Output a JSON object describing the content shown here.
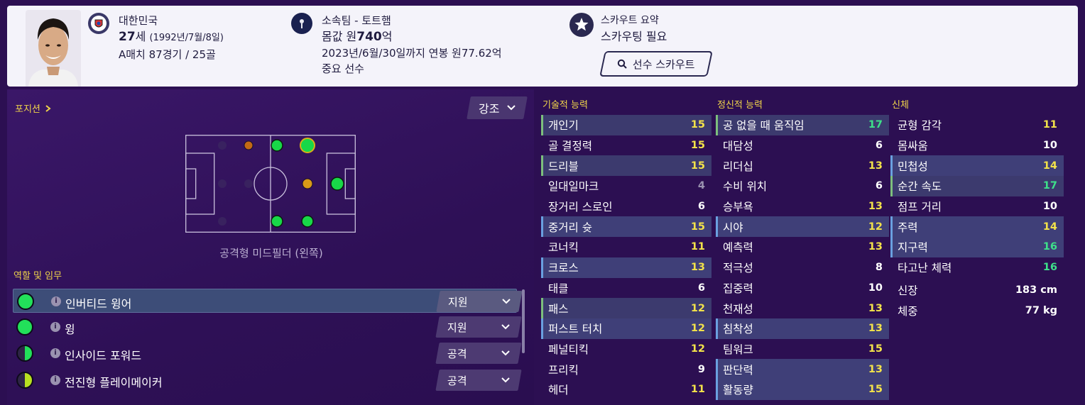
{
  "header": {
    "nation": "대한민국",
    "age_num": "27",
    "age_suffix": "세",
    "birth": "(1992년/7월/8일)",
    "caps": "A매치 87경기 / 25골",
    "club": "소속팀 - 토트햄",
    "value_prefix": "몸값 원",
    "value_num": "740",
    "value_suffix": "억",
    "contract": "2023년/6월/30일까지 연봉 원77.62억",
    "status": "중요 선수",
    "scout_title": "스카우트 요약",
    "scout_status": "스카우팅 필요",
    "scout_button": "선수 스카우트"
  },
  "left": {
    "positions_title": "포지션",
    "emphasis_label": "강조",
    "position_name": "공격형 미드필더 (왼쪽)",
    "roles_title": "역할 및 임무",
    "roles": [
      {
        "name": "인버티드 윙어",
        "duty": "지원",
        "fill": "full"
      },
      {
        "name": "윙",
        "duty": "지원",
        "fill": "full"
      },
      {
        "name": "인사이드 포워드",
        "duty": "공격",
        "fill": "half"
      },
      {
        "name": "전진형 플레이메이커",
        "duty": "공격",
        "fill": "half"
      }
    ]
  },
  "attributes": {
    "technical": {
      "title": "기술적 능력",
      "items": [
        {
          "name": "개인기",
          "value": "15",
          "color": "#f2e24a",
          "hl": "green"
        },
        {
          "name": "골 결정력",
          "value": "15",
          "color": "#f2e24a",
          "hl": ""
        },
        {
          "name": "드리블",
          "value": "15",
          "color": "#f2e24a",
          "hl": "green"
        },
        {
          "name": "일대일마크",
          "value": "4",
          "color": "#9a92b0",
          "hl": ""
        },
        {
          "name": "장거리 스로인",
          "value": "6",
          "color": "#ffffff",
          "hl": ""
        },
        {
          "name": "중거리 슛",
          "value": "15",
          "color": "#f2e24a",
          "hl": "blue"
        },
        {
          "name": "코너킥",
          "value": "11",
          "color": "#f2e24a",
          "hl": ""
        },
        {
          "name": "크로스",
          "value": "13",
          "color": "#f2e24a",
          "hl": "blue"
        },
        {
          "name": "태클",
          "value": "6",
          "color": "#ffffff",
          "hl": ""
        },
        {
          "name": "패스",
          "value": "12",
          "color": "#f2e24a",
          "hl": "green"
        },
        {
          "name": "퍼스트 터치",
          "value": "12",
          "color": "#f2e24a",
          "hl": "blue"
        },
        {
          "name": "페널티킥",
          "value": "12",
          "color": "#f2e24a",
          "hl": ""
        },
        {
          "name": "프리킥",
          "value": "9",
          "color": "#ffffff",
          "hl": ""
        },
        {
          "name": "헤더",
          "value": "11",
          "color": "#f2e24a",
          "hl": ""
        }
      ]
    },
    "mental": {
      "title": "정신적 능력",
      "items": [
        {
          "name": "공 없을 때 움직임",
          "value": "17",
          "color": "#3ee08a",
          "hl": "green"
        },
        {
          "name": "대담성",
          "value": "6",
          "color": "#ffffff",
          "hl": ""
        },
        {
          "name": "리더십",
          "value": "13",
          "color": "#f2e24a",
          "hl": ""
        },
        {
          "name": "수비 위치",
          "value": "6",
          "color": "#ffffff",
          "hl": ""
        },
        {
          "name": "승부욕",
          "value": "13",
          "color": "#f2e24a",
          "hl": ""
        },
        {
          "name": "시야",
          "value": "12",
          "color": "#f2e24a",
          "hl": "blue"
        },
        {
          "name": "예측력",
          "value": "13",
          "color": "#f2e24a",
          "hl": ""
        },
        {
          "name": "적극성",
          "value": "8",
          "color": "#ffffff",
          "hl": ""
        },
        {
          "name": "집중력",
          "value": "10",
          "color": "#ffffff",
          "hl": ""
        },
        {
          "name": "천재성",
          "value": "13",
          "color": "#f2e24a",
          "hl": ""
        },
        {
          "name": "침착성",
          "value": "13",
          "color": "#f2e24a",
          "hl": "blue"
        },
        {
          "name": "팀워크",
          "value": "15",
          "color": "#f2e24a",
          "hl": ""
        },
        {
          "name": "판단력",
          "value": "13",
          "color": "#f2e24a",
          "hl": "blue"
        },
        {
          "name": "활동량",
          "value": "15",
          "color": "#f2e24a",
          "hl": "blue"
        }
      ]
    },
    "physical": {
      "title": "신체",
      "items": [
        {
          "name": "균형 감각",
          "value": "11",
          "color": "#f2e24a",
          "hl": ""
        },
        {
          "name": "몸싸움",
          "value": "10",
          "color": "#ffffff",
          "hl": ""
        },
        {
          "name": "민첩성",
          "value": "14",
          "color": "#f2e24a",
          "hl": "blue"
        },
        {
          "name": "순간 속도",
          "value": "17",
          "color": "#3ee08a",
          "hl": "green"
        },
        {
          "name": "점프 거리",
          "value": "10",
          "color": "#ffffff",
          "hl": ""
        },
        {
          "name": "주력",
          "value": "14",
          "color": "#f2e24a",
          "hl": "blue"
        },
        {
          "name": "지구력",
          "value": "16",
          "color": "#3ee08a",
          "hl": "blue"
        },
        {
          "name": "타고난 체력",
          "value": "16",
          "color": "#3ee08a",
          "hl": ""
        },
        {
          "name": "신장",
          "value": "183 cm",
          "color": "#ffffff",
          "hl": ""
        },
        {
          "name": "체중",
          "value": "77 kg",
          "color": "#ffffff",
          "hl": ""
        }
      ]
    }
  }
}
